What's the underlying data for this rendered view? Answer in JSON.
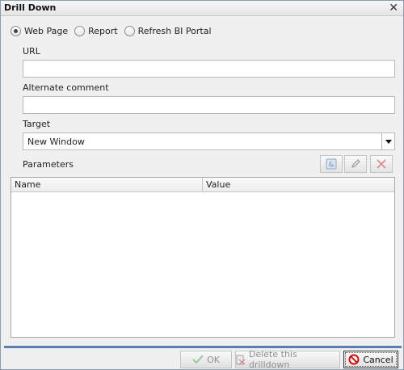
{
  "dialog": {
    "title": "Drill Down",
    "close_icon": "close-icon"
  },
  "link_type": {
    "options": [
      {
        "label": "Web Page",
        "selected": true
      },
      {
        "label": "Report",
        "selected": false
      },
      {
        "label": "Refresh BI Portal",
        "selected": false
      }
    ]
  },
  "url": {
    "label": "URL",
    "value": ""
  },
  "alternate_comment": {
    "label": "Alternate comment",
    "value": ""
  },
  "target": {
    "label": "Target",
    "selected": "New Window"
  },
  "parameters": {
    "label": "Parameters",
    "toolbar": {
      "add_icon": "add-parameter-icon",
      "edit_icon": "pencil-icon",
      "delete_icon": "delete-x-icon"
    },
    "columns": [
      "Name",
      "Value"
    ],
    "rows": []
  },
  "footer": {
    "ok_label": "OK",
    "delete_label": "Delete this drilldown",
    "cancel_label": "Cancel"
  }
}
